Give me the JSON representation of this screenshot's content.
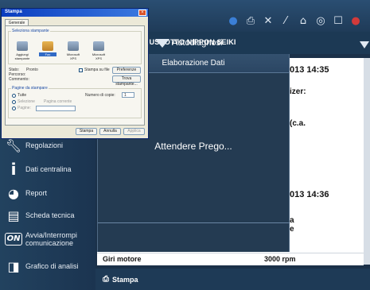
{
  "toolbar": {
    "icons": [
      "globe-icon",
      "printer-icon",
      "tools-icon",
      "wand-icon",
      "home-icon",
      "camera-icon",
      "window-icon"
    ]
  },
  "header": {
    "dashboard_title": "RUSCOTTO NIPPON SEIKI",
    "autodiag_label": "Autodiagnosi"
  },
  "sidebar": {
    "items": [
      {
        "label": "Regolazioni",
        "icon": "wrench-icon"
      },
      {
        "label": "Dati centralina",
        "icon": "info-icon"
      },
      {
        "label": "Report",
        "icon": "report-icon"
      },
      {
        "label": "Scheda tecnica",
        "icon": "document-icon"
      },
      {
        "label": "Avvia/Interrompi comunicazione",
        "icon": "on-icon",
        "badge": "ON"
      },
      {
        "label": "Grafico di analisi",
        "icon": "chart-icon"
      }
    ]
  },
  "overlay": {
    "title": "Elaborazione Dati",
    "message": "Attendere Prego..."
  },
  "panel": {
    "lines": [
      "013 14:35",
      "izer:",
      "(c.a.",
      "013 14:36",
      "a",
      "e"
    ],
    "row_key": "Giri motore",
    "row_value": "3000 rpm"
  },
  "bottom": {
    "print_label": "Stampa"
  },
  "dialog": {
    "title": "Stampa",
    "tab": "Generale",
    "group_printer": "Seleziona stampante",
    "printers": [
      "Aggiungi stampante",
      "Fax",
      "Microsoft XPS",
      "Microsoft XPS"
    ],
    "status_label": "Stato:",
    "status_value": "Pronto",
    "location_label": "Percorso:",
    "comment_label": "Commento:",
    "print_to_file": "Stampa su file",
    "preferences_btn": "Preferenze",
    "find_btn": "Trova stampante...",
    "group_pages": "Pagine da stampare",
    "all_pages": "Tutte",
    "selection": "Selezione",
    "current_page": "Pagina corrente",
    "pages": "Pagine:",
    "copies_label": "Numero di copie:",
    "copies_value": "1",
    "ok_btn": "Stampa",
    "cancel_btn": "Annulla",
    "apply_btn": "Applica"
  }
}
